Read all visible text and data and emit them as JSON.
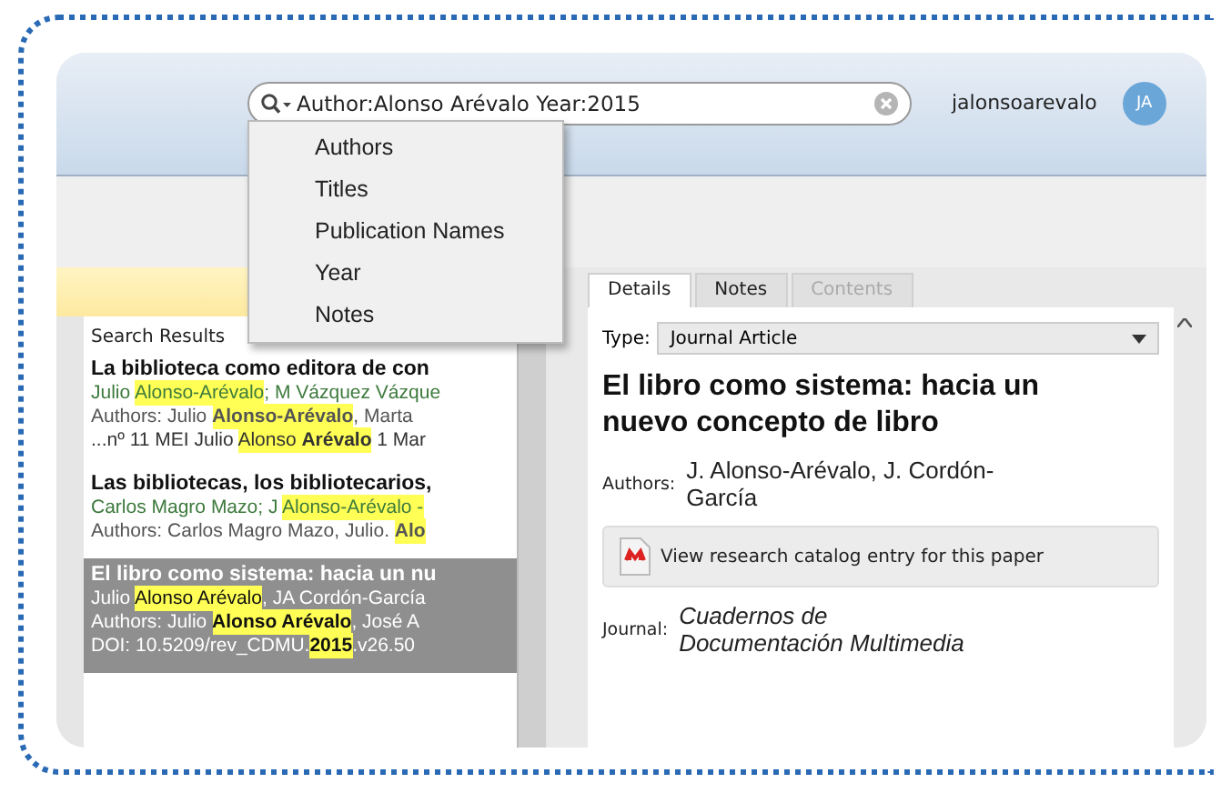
{
  "search": {
    "value": "Author:Alonso Arévalo Year:2015"
  },
  "user": {
    "name": "jalonsoarevalo",
    "initials": "JA"
  },
  "search_menu": {
    "items": [
      "Authors",
      "Titles",
      "Publication Names",
      "Year",
      "Notes"
    ]
  },
  "results": {
    "heading": "Search Results",
    "items": [
      {
        "selected": false,
        "lines": [
          {
            "kind": "title",
            "segments": [
              {
                "text": "La biblioteca como editora de con",
                "highlighted": false
              }
            ]
          },
          {
            "kind": "source",
            "segments": [
              {
                "text": "Julio ",
                "highlighted": false
              },
              {
                "text": "Alonso-Arévalo",
                "highlighted": true
              },
              {
                "text": "; M Vázquez Vázque",
                "highlighted": false
              }
            ]
          },
          {
            "kind": "authors",
            "segments": [
              {
                "text": "Authors: Julio ",
                "highlighted": false
              },
              {
                "text": "**Alonso-Arévalo**",
                "highlighted": true
              },
              {
                "text": ", Marta",
                "highlighted": false
              }
            ]
          },
          {
            "kind": "snippet",
            "segments": [
              {
                "text": "...nº 11 MEI Julio ",
                "highlighted": false
              },
              {
                "text": "Alonso **Arévalo**",
                "highlighted": true
              },
              {
                "text": " 1 Mar",
                "highlighted": false
              }
            ]
          }
        ]
      },
      {
        "selected": false,
        "lines": [
          {
            "kind": "title",
            "segments": [
              {
                "text": "Las bibliotecas, los bibliotecarios,",
                "highlighted": false
              }
            ]
          },
          {
            "kind": "source",
            "segments": [
              {
                "text": "Carlos Magro Mazo; J ",
                "highlighted": false
              },
              {
                "text": "Alonso-Arévalo -",
                "highlighted": true
              }
            ]
          },
          {
            "kind": "authors",
            "segments": [
              {
                "text": "Authors: Carlos Magro Mazo, Julio. ",
                "highlighted": false
              },
              {
                "text": "**Alo**",
                "highlighted": true
              }
            ]
          }
        ]
      },
      {
        "selected": true,
        "lines": [
          {
            "kind": "title",
            "segments": [
              {
                "text": "El libro como sistema: hacia un nu",
                "highlighted": false
              }
            ]
          },
          {
            "kind": "source",
            "segments": [
              {
                "text": "Julio ",
                "highlighted": false
              },
              {
                "text": "Alonso Arévalo",
                "highlighted": true
              },
              {
                "text": ", JA Cordón-García",
                "highlighted": false
              }
            ]
          },
          {
            "kind": "authors",
            "segments": [
              {
                "text": "Authors: Julio ",
                "highlighted": false
              },
              {
                "text": "**Alonso Arévalo**",
                "highlighted": true
              },
              {
                "text": ", José A",
                "highlighted": false
              }
            ]
          },
          {
            "kind": "snippet",
            "segments": [
              {
                "text": "DOI: 10.5209/rev_CDMU.",
                "highlighted": false
              },
              {
                "text": "**2015**",
                "highlighted": true
              },
              {
                "text": ".v26.50",
                "highlighted": false
              }
            ]
          }
        ]
      }
    ]
  },
  "details": {
    "tabs": [
      {
        "label": "Details",
        "selected": true,
        "disabled": false
      },
      {
        "label": "Notes",
        "selected": false,
        "disabled": false
      },
      {
        "label": "Contents",
        "selected": false,
        "disabled": true
      }
    ],
    "type_label": "Type:",
    "type_value": "Journal Article",
    "title": "El libro como sistema: hacia un nuevo concepto de libro",
    "authors": {
      "label": "Authors:",
      "value": "J. Alonso-Arévalo, J. Cordón-García"
    },
    "catalog_button": "View research catalog entry for this paper",
    "journal": {
      "label": "Journal:",
      "value": "Cuadernos de Documentación Multimedia"
    }
  }
}
